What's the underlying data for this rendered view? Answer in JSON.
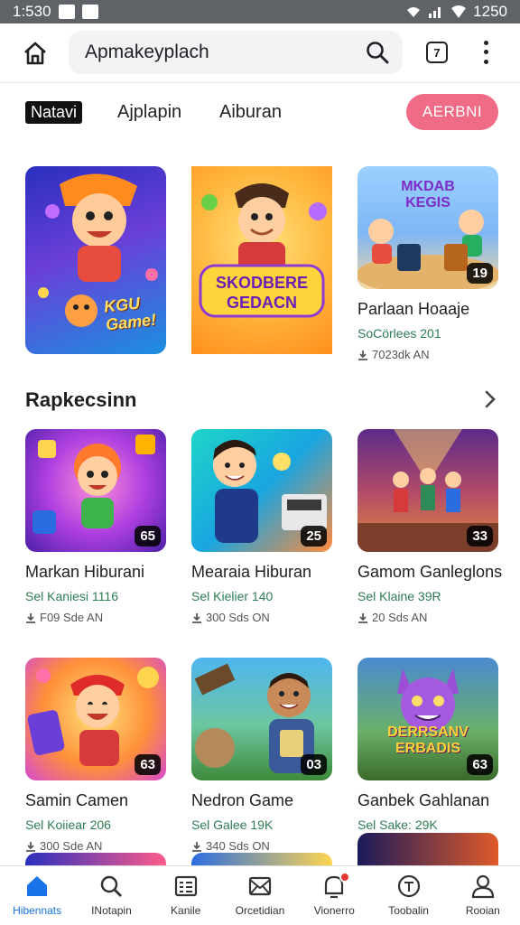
{
  "status": {
    "time": "1:530",
    "right_time": "1250"
  },
  "header": {
    "search_value": "Apmakeyplach",
    "tab_count": "7"
  },
  "filters": {
    "active": "Natavi",
    "tab2": "Ajplapin",
    "tab3": "Aiburan",
    "cta": "AERBNI"
  },
  "featured": [
    {
      "title": "",
      "badge": ""
    },
    {
      "title": "",
      "badge": ""
    },
    {
      "title": "Parlaan Hoaaje",
      "subtitle": "SoCörlees 201",
      "meta": "7023dk AN",
      "badge": "19"
    }
  ],
  "featured_art": {
    "card1": "KGU Game!",
    "card2": "SKODBERE GEDACN",
    "card3": "MKDAB KEGIS"
  },
  "section": {
    "title": "Rapkecsinn"
  },
  "grid": [
    {
      "title": "Markan Hiburani",
      "subtitle": "Sel Kaniesi 1116",
      "meta": "F09 Sde AN",
      "badge": "65"
    },
    {
      "title": "Mearaia Hiburan",
      "subtitle": "Sel Kielier 140",
      "meta": "300 Sds ON",
      "badge": "25"
    },
    {
      "title": "Gamom Ganleglons",
      "subtitle": "Sel Klaine 39R",
      "meta": "20 Sds AN",
      "badge": "33"
    },
    {
      "title": "Samin Camen",
      "subtitle": "Sel Koiiear 206",
      "meta": "300 Sde AN",
      "badge": "63"
    },
    {
      "title": "Nedron Game",
      "subtitle": "Sel Galee 19K",
      "meta": "340 Sds ON",
      "badge": "03"
    },
    {
      "title": "Ganbek Gahlanan",
      "subtitle": "Sel Sake: 29K",
      "meta": "",
      "badge": "63"
    }
  ],
  "grid_art": {
    "card6": "DERRSANV ERBADIS"
  },
  "nav": [
    {
      "label": "Hibennats",
      "icon": "home-icon"
    },
    {
      "label": "INotapin",
      "icon": "search-icon"
    },
    {
      "label": "Kanile",
      "icon": "list-icon"
    },
    {
      "label": "Orcetidian",
      "icon": "mail-icon"
    },
    {
      "label": "Vionerro",
      "icon": "notification-icon"
    },
    {
      "label": "Toobalin",
      "icon": "compass-icon"
    },
    {
      "label": "Rooian",
      "icon": "profile-icon"
    }
  ],
  "colors": {
    "accent": "#1a73e8",
    "cta": "#f06b86",
    "subtitle": "#2e7d52"
  }
}
